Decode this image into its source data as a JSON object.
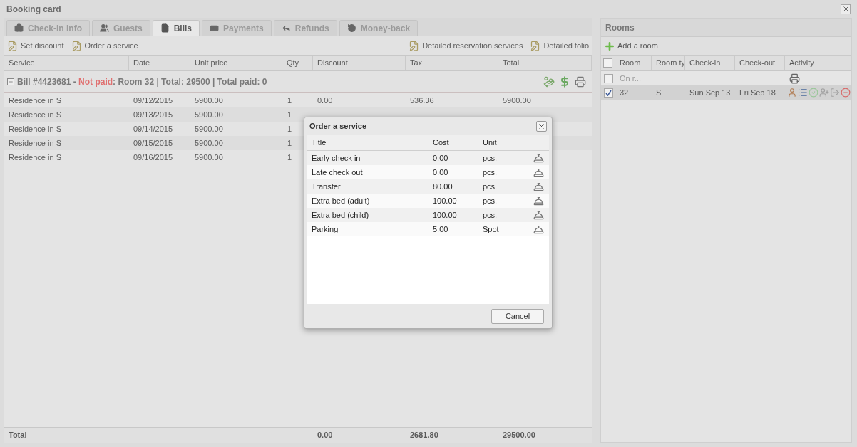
{
  "window": {
    "title": "Booking card"
  },
  "tabs": [
    {
      "label": "Check-in info",
      "kind": "briefcase",
      "selected": false
    },
    {
      "label": "Guests",
      "kind": "users",
      "selected": false
    },
    {
      "label": "Bills",
      "kind": "file",
      "selected": true
    },
    {
      "label": "Payments",
      "kind": "money",
      "selected": false
    },
    {
      "label": "Refunds",
      "kind": "reply",
      "selected": false
    },
    {
      "label": "Money-back",
      "kind": "undo",
      "selected": false
    }
  ],
  "toolbar_left": [
    "Set discount",
    "Order a service"
  ],
  "toolbar_right": [
    "Detailed reservation services",
    "Detailed folio"
  ],
  "bill_table": {
    "columns": [
      "Service",
      "Date",
      "Unit price",
      "Qty",
      "Discount",
      "Tax",
      "Total"
    ],
    "group": {
      "title": "Bill #4423681 -",
      "status": "Not paid",
      "details": ": Room 32 | Total: 29500 | Total paid: 0"
    },
    "rows": [
      [
        "Residence in S",
        "09/12/2015",
        "5900.00",
        "1",
        "0.00",
        "536.36",
        "5900.00"
      ],
      [
        "Residence in S",
        "09/13/2015",
        "5900.00",
        "1"
      ],
      [
        "Residence in S",
        "09/14/2015",
        "5900.00",
        "1"
      ],
      [
        "Residence in S",
        "09/15/2015",
        "5900.00",
        "1"
      ],
      [
        "Residence in S",
        "09/16/2015",
        "5900.00",
        "1"
      ]
    ],
    "footer": {
      "label": "Total",
      "discount": "0.00",
      "tax": "2681.80",
      "total": "29500.00"
    }
  },
  "rooms": {
    "title": "Rooms",
    "add_button": "Add a room",
    "columns": [
      "Room",
      "Room ty",
      "Check-in",
      "Check-out",
      "Activity"
    ],
    "header_checked": false,
    "rows": [
      {
        "kind": "summary",
        "checked": false,
        "cells": [
          "On r..."
        ]
      },
      {
        "kind": "room",
        "checked": true,
        "cells": [
          "32",
          "S",
          "Sun Sep 13",
          "Fri Sep 18"
        ]
      }
    ]
  },
  "dialog": {
    "title": "Order a service",
    "columns": [
      "Title",
      "Cost",
      "Unit"
    ],
    "rows": [
      [
        "Early check in",
        "0.00",
        "pcs."
      ],
      [
        "Late check out",
        "0.00",
        "pcs."
      ],
      [
        "Transfer",
        "80.00",
        "pcs."
      ],
      [
        "Extra bed (adult)",
        "100.00",
        "pcs."
      ],
      [
        "Extra bed (child)",
        "100.00",
        "pcs."
      ],
      [
        "Parking",
        "5.00",
        "Spot"
      ]
    ],
    "cancel": "Cancel"
  }
}
